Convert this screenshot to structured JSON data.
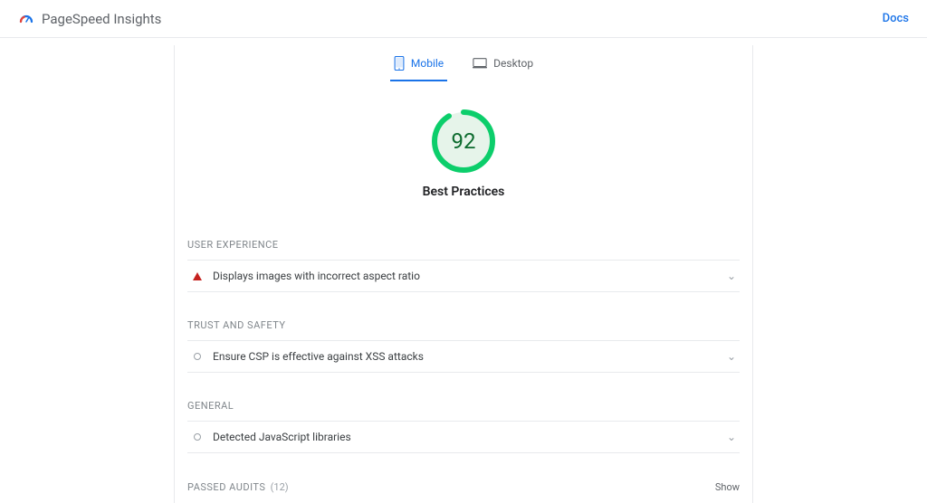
{
  "header": {
    "title": "PageSpeed Insights",
    "docs_label": "Docs"
  },
  "tabs": {
    "mobile": "Mobile",
    "desktop": "Desktop"
  },
  "score": {
    "value": "92",
    "title": "Best Practices",
    "percent": 92
  },
  "sections": {
    "user_experience": {
      "title": "USER EXPERIENCE",
      "items": [
        {
          "text": "Displays images with incorrect aspect ratio",
          "icon": "warning"
        }
      ]
    },
    "trust_safety": {
      "title": "TRUST AND SAFETY",
      "items": [
        {
          "text": "Ensure CSP is effective against XSS attacks",
          "icon": "info"
        }
      ]
    },
    "general": {
      "title": "GENERAL",
      "items": [
        {
          "text": "Detected JavaScript libraries",
          "icon": "info"
        }
      ]
    }
  },
  "passed": {
    "label": "PASSED AUDITS",
    "count": "(12)",
    "show": "Show"
  }
}
